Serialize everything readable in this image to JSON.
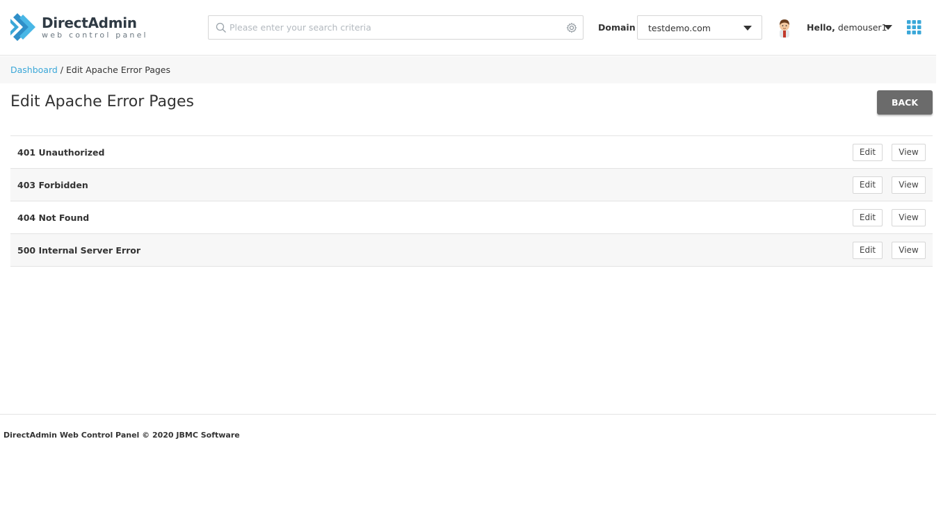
{
  "header": {
    "logo_title": "DirectAdmin",
    "logo_subtitle": "web control panel",
    "search_placeholder": "Please enter your search criteria",
    "domain_label": "Domain",
    "domain_value": "testdemo.com",
    "hello_label": "Hello,",
    "username": "demouser1",
    "accent_color": "#3aa7d8"
  },
  "breadcrumb": {
    "home": "Dashboard",
    "separator": " / ",
    "current": "Edit Apache Error Pages"
  },
  "page": {
    "title": "Edit Apache Error Pages",
    "back_label": "BACK"
  },
  "error_pages": [
    {
      "label": "401 Unauthorized",
      "edit": "Edit",
      "view": "View"
    },
    {
      "label": "403 Forbidden",
      "edit": "Edit",
      "view": "View"
    },
    {
      "label": "404 Not Found",
      "edit": "Edit",
      "view": "View"
    },
    {
      "label": "500 Internal Server Error",
      "edit": "Edit",
      "view": "View"
    }
  ],
  "footer": {
    "text": "DirectAdmin Web Control Panel © 2020 JBMC Software"
  }
}
